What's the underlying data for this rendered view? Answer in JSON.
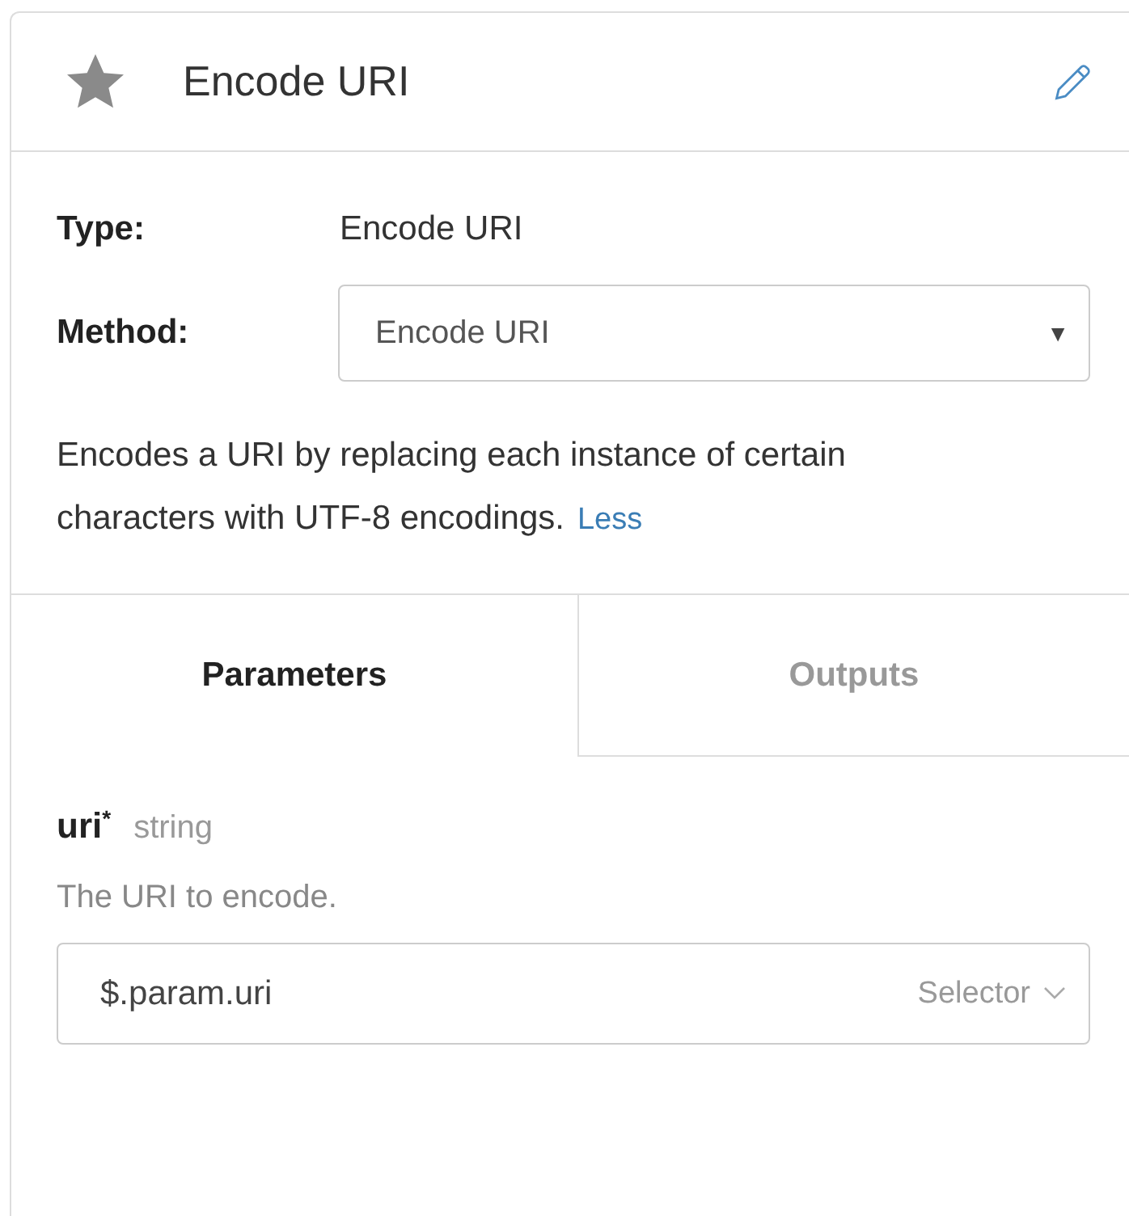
{
  "header": {
    "title": "Encode URI"
  },
  "type_row": {
    "label": "Type:",
    "value": "Encode URI"
  },
  "method_row": {
    "label": "Method:",
    "value": "Encode URI",
    "arrow": "▼"
  },
  "description": {
    "text": "Encodes a URI by replacing each instance of certain characters with UTF-8 encodings.",
    "link": "Less"
  },
  "tabs": [
    {
      "label": "Parameters",
      "selected": true
    },
    {
      "label": "Outputs",
      "selected": false
    }
  ],
  "parameters": [
    {
      "name": "uri",
      "required_mark": "*",
      "type": "string",
      "description": "The URI to encode.",
      "value": "$.param.uri",
      "mode": "Selector"
    }
  ]
}
